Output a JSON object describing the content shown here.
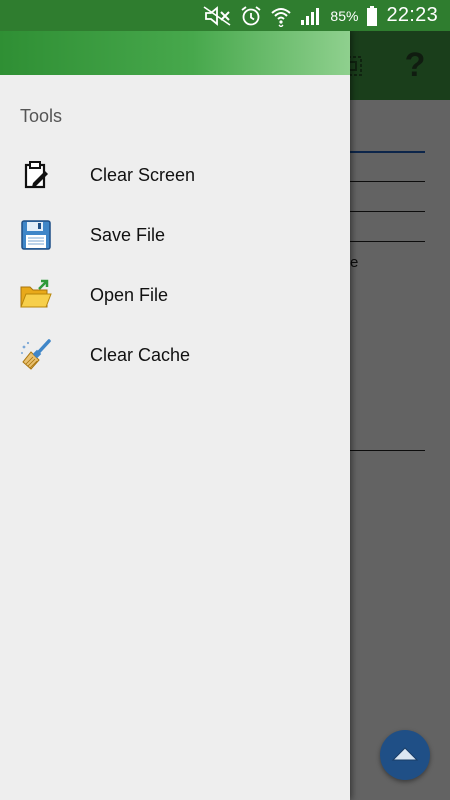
{
  "status_bar": {
    "battery": "85%",
    "time": "22:23",
    "icons": [
      "mute-icon",
      "alarm-icon",
      "wifi-icon",
      "signal-icon",
      "battery-icon"
    ],
    "background_color": "#2f7d2f"
  },
  "drawer": {
    "section_title": "Tools",
    "items": [
      {
        "label": "Clear Screen",
        "icon": "clipboard-icon"
      },
      {
        "label": "Save File",
        "icon": "floppy-disk-icon"
      },
      {
        "label": "Open File",
        "icon": "open-folder-icon"
      },
      {
        "label": "Clear Cache",
        "icon": "broom-icon"
      }
    ]
  },
  "background_app": {
    "toolbar_color": "#43a047",
    "toolbar_icons": [
      "grid-icon",
      "help-icon"
    ],
    "help_glyph": "?",
    "partial_text": "e"
  },
  "fab": {
    "icon": "chevron-up-icon",
    "color": "#1f4f86"
  }
}
